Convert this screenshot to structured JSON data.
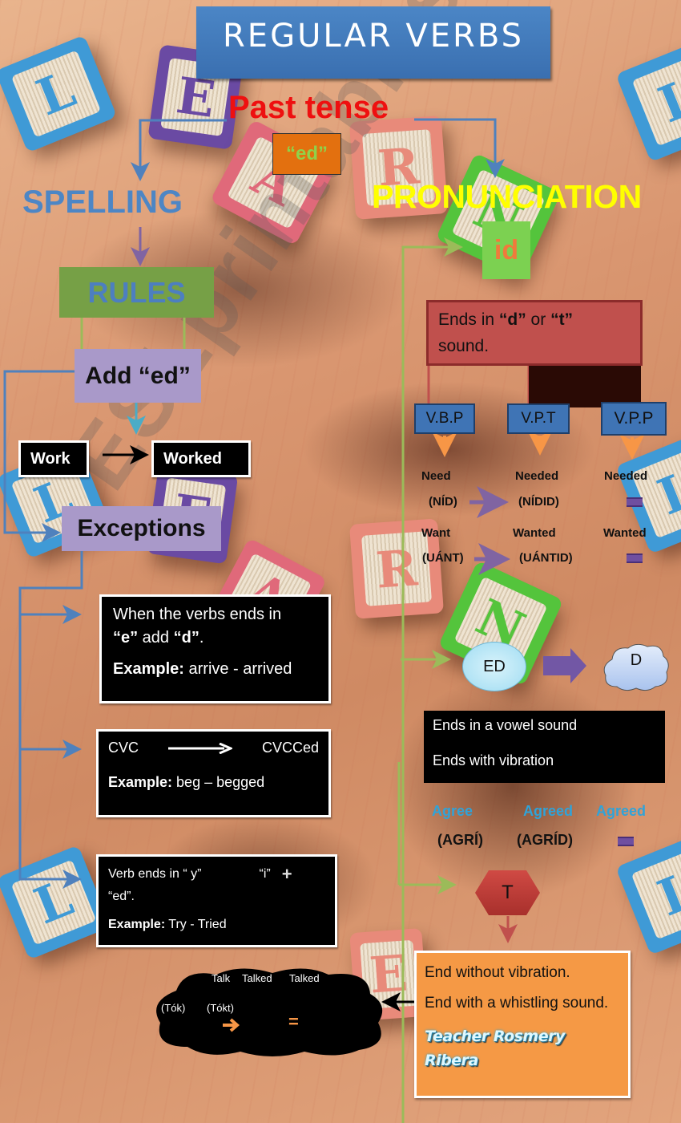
{
  "title": "REGULAR VERBS",
  "root": {
    "label": "Past tense",
    "suffix": "“ed”"
  },
  "spelling": {
    "heading": "SPELLING",
    "rules_label": "RULES",
    "add_ed": "Add “ed”",
    "example": {
      "base": "Work",
      "past": "Worked"
    },
    "exceptions_label": "Exceptions",
    "exceptions": [
      {
        "line1": "When the verbs ends in",
        "q1": "“e”",
        "mid": " add ",
        "q2": "“d”",
        "end": ".",
        "example_label": "Example:",
        "example": " arrive - arrived"
      },
      {
        "from": "CVC",
        "to": "CVCCed",
        "example_label": "Example:",
        "example": " beg – begged"
      },
      {
        "line1": "Verb ends in “ y”",
        "to": "“i”",
        "plus": "+",
        "line2": "“ed”.",
        "example_label": "Example:",
        "example": " Try - Tried"
      }
    ]
  },
  "pronunciation": {
    "heading": "PRONUNCIATION",
    "id_sound": {
      "label": "id",
      "rule_prefix": "Ends in ",
      "d": "“d”",
      "or": " or ",
      "t": "“t”",
      "rule_suffix": "sound.",
      "columns": [
        "V.B.P",
        "V.P.T",
        "V.P.P"
      ],
      "rows": [
        {
          "base": "Need",
          "past": "Needed",
          "participle": "Needed",
          "base_ph": "(NÍD)",
          "past_ph": "(NÍDID)"
        },
        {
          "base": "Want",
          "past": "Wanted",
          "participle": "Wanted",
          "base_ph": "(UÁNT)",
          "past_ph": "(UÁNTID)"
        }
      ]
    },
    "d_sound": {
      "from": "ED",
      "to": "D",
      "rules": [
        "Ends in a vowel sound",
        "Ends with vibration"
      ],
      "example": {
        "base": "Agree",
        "past": "Agreed",
        "participle": "Agreed",
        "base_ph": "(AGRÍ)",
        "past_ph": "(AGRÍD)"
      }
    },
    "t_sound": {
      "label": "T",
      "rules": [
        "End without vibration.",
        "End with a whistling sound."
      ],
      "example": {
        "base": "Talk",
        "past": "Talked",
        "participle": "Talked",
        "base_ph": "(Tók)",
        "past_ph": "(Tókt)",
        "equals": "="
      }
    }
  },
  "signature": "Teacher Rosmery Ribera",
  "watermark": "ESLprintables.com",
  "colors": {
    "title_bg": "#3f78ba",
    "past_tense": "#ee1010",
    "spelling": "#4d86c5",
    "pronunciation": "#ffff00",
    "rules_bg": "#76a046",
    "lavender": "#a999c9",
    "id_rule_bg": "#c0504d",
    "t_rule_bg": "#f59945",
    "connector_blue": "#4f81bd",
    "connector_green": "#9bbb59"
  }
}
